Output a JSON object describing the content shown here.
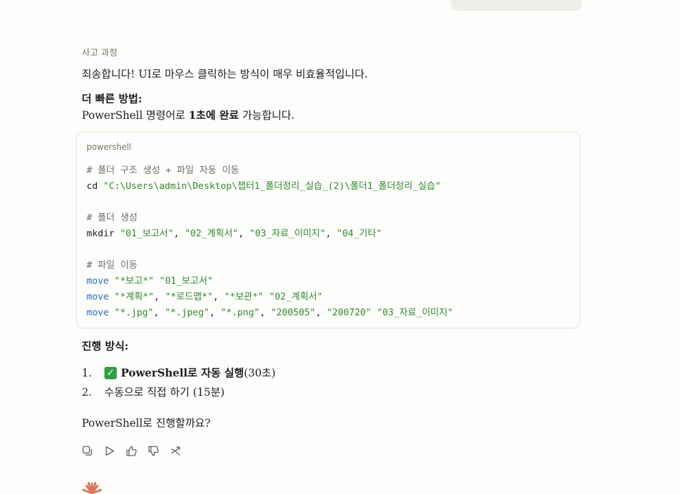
{
  "thinking": {
    "label": "사고 과정"
  },
  "response": {
    "intro": "죄송합니다! UI로 마우스 클릭하는 방식이 매우 비효율적입니다.",
    "faster_heading": "더 빠른 방법:",
    "faster_line_prefix": "PowerShell 명령어로 ",
    "faster_line_bold": "1초에 완료",
    "faster_line_suffix": " 가능합니다.",
    "code": {
      "language": "powershell",
      "lines": [
        [
          {
            "c": "cm",
            "t": "# 폴더 구조 생성 + 파일 자동 이동"
          }
        ],
        [
          {
            "c": "tx",
            "t": "cd "
          },
          {
            "c": "st",
            "t": "\"C:\\Users\\admin\\Desktop\\챕터1_폴더정리_실습_(2)\\폴더1_폴더정리_실습\""
          }
        ],
        [],
        [
          {
            "c": "cm",
            "t": "# 폴더 생성"
          }
        ],
        [
          {
            "c": "tx",
            "t": "mkdir "
          },
          {
            "c": "st",
            "t": "\"01_보고서\""
          },
          {
            "c": "tx",
            "t": ", "
          },
          {
            "c": "st",
            "t": "\"02_계획서\""
          },
          {
            "c": "tx",
            "t": ", "
          },
          {
            "c": "st",
            "t": "\"03_자료_이미지\""
          },
          {
            "c": "tx",
            "t": ", "
          },
          {
            "c": "st",
            "t": "\"04_기타\""
          }
        ],
        [],
        [
          {
            "c": "cm",
            "t": "# 파일 이동"
          }
        ],
        [
          {
            "c": "kw",
            "t": "move "
          },
          {
            "c": "st",
            "t": "\"*보고*\" \"01_보고서\""
          }
        ],
        [
          {
            "c": "kw",
            "t": "move "
          },
          {
            "c": "st",
            "t": "\"*계획*\""
          },
          {
            "c": "tx",
            "t": ", "
          },
          {
            "c": "st",
            "t": "\"*로드맵*\""
          },
          {
            "c": "tx",
            "t": ", "
          },
          {
            "c": "st",
            "t": "\"*보관*\" \"02_계획서\""
          }
        ],
        [
          {
            "c": "kw",
            "t": "move "
          },
          {
            "c": "st",
            "t": "\"*.jpg\""
          },
          {
            "c": "tx",
            "t": ", "
          },
          {
            "c": "st",
            "t": "\"*.jpeg\""
          },
          {
            "c": "tx",
            "t": ", "
          },
          {
            "c": "st",
            "t": "\"*.png\""
          },
          {
            "c": "tx",
            "t": ", "
          },
          {
            "c": "st",
            "t": "\"200505\""
          },
          {
            "c": "tx",
            "t": ", "
          },
          {
            "c": "st",
            "t": "\"200720\" \"03_자료_이미지\""
          }
        ]
      ]
    },
    "method_heading": "진행 방식:",
    "options": [
      {
        "num": "1.",
        "check": "✓",
        "bold": "PowerShell로 자동 실행",
        "rest": " (30초)"
      },
      {
        "num": "2.",
        "text": "수동으로 직접 하기 (15분)"
      }
    ],
    "question": "PowerShell로 진행할까요?"
  },
  "actions": [
    "copy-icon",
    "play-icon",
    "thumbs-up-icon",
    "thumbs-down-icon",
    "share-icon"
  ],
  "colors": {
    "comment": "#6f6e69",
    "keyword": "#1f6fc5",
    "string": "#2c8a27",
    "logo": "#d97757",
    "check": "#2ea043"
  }
}
